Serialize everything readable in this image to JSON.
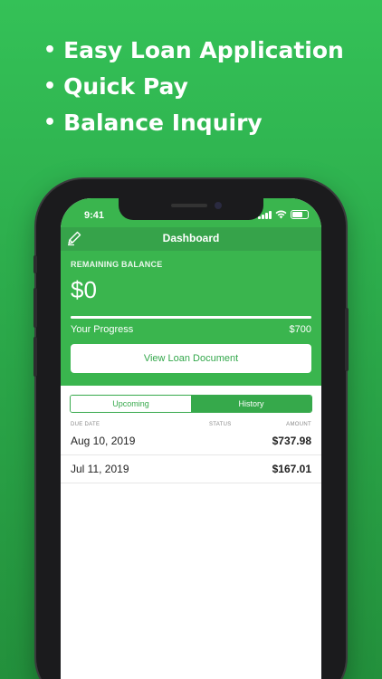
{
  "promo": {
    "bullets": [
      "Easy Loan Application",
      "Quick Pay",
      "Balance Inquiry"
    ]
  },
  "status_bar": {
    "time": "9:41"
  },
  "nav": {
    "title": "Dashboard",
    "left_icon": "edit-pen-icon"
  },
  "balance": {
    "label": "REMAINING BALANCE",
    "amount": "$0",
    "progress_label": "Your Progress",
    "progress_amount": "$700",
    "progress_fraction": 1.0
  },
  "view_loan_button": "View Loan Document",
  "tabs": {
    "upcoming": "Upcoming",
    "history": "History",
    "selected": "history"
  },
  "table": {
    "headers": {
      "due_date": "DUE DATE",
      "status": "STATUS",
      "amount": "AMOUNT"
    },
    "rows": [
      {
        "date": "Aug 10, 2019",
        "amount": "$737.98"
      },
      {
        "date": "Jul 11, 2019",
        "amount": "$167.01"
      }
    ]
  },
  "colors": {
    "brand_green": "#3ab54e",
    "nav_green": "#36a34a",
    "background_green": "#2aa548"
  }
}
